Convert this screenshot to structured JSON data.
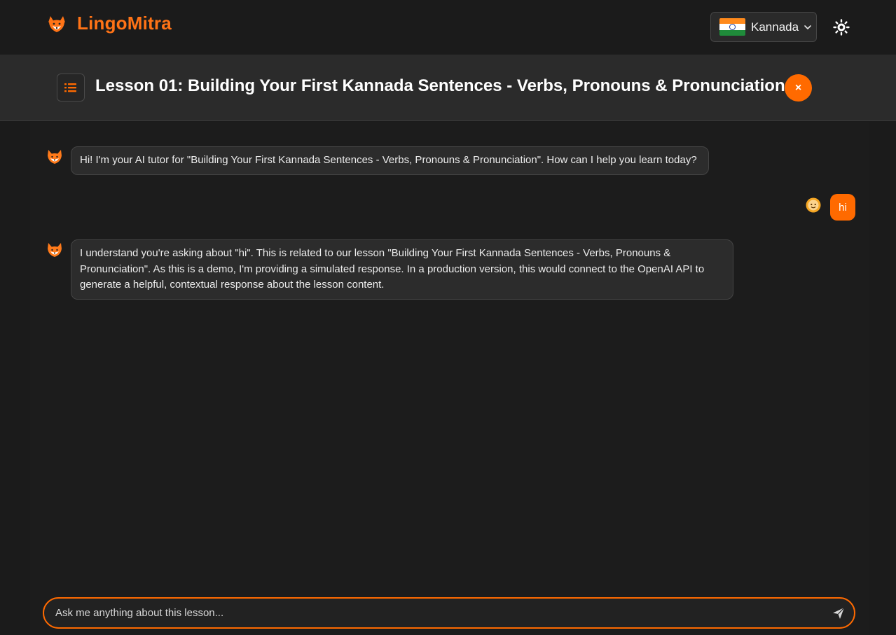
{
  "app": {
    "name": "LingoMitra",
    "accent": "#ff6a00"
  },
  "language_selector": {
    "selected": "Kannada",
    "flag": "india-flag-icon"
  },
  "lesson": {
    "title": "Lesson 01: Building Your First Kannada Sentences - Verbs, Pronouns & Pronunciation",
    "close_label": "×"
  },
  "messages": [
    {
      "role": "tutor",
      "avatar": "fox-icon",
      "text": "Hi! I'm your AI tutor for \"Building Your First Kannada Sentences - Verbs, Pronouns & Pronunciation\". How can I help you learn today?"
    },
    {
      "role": "user",
      "avatar": "user-avatar-icon",
      "text": "hi"
    },
    {
      "role": "tutor",
      "avatar": "fox-icon",
      "text": "I understand you're asking about \"hi\". This is related to our lesson \"Building Your First Kannada Sentences - Verbs, Pronouns & Pronunciation\". As this is a demo, I'm providing a simulated response. In a production version, this would connect to the OpenAI API to generate a helpful, contextual response about the lesson content."
    }
  ],
  "chat_input": {
    "placeholder": "Ask me anything about this lesson...",
    "value": ""
  }
}
